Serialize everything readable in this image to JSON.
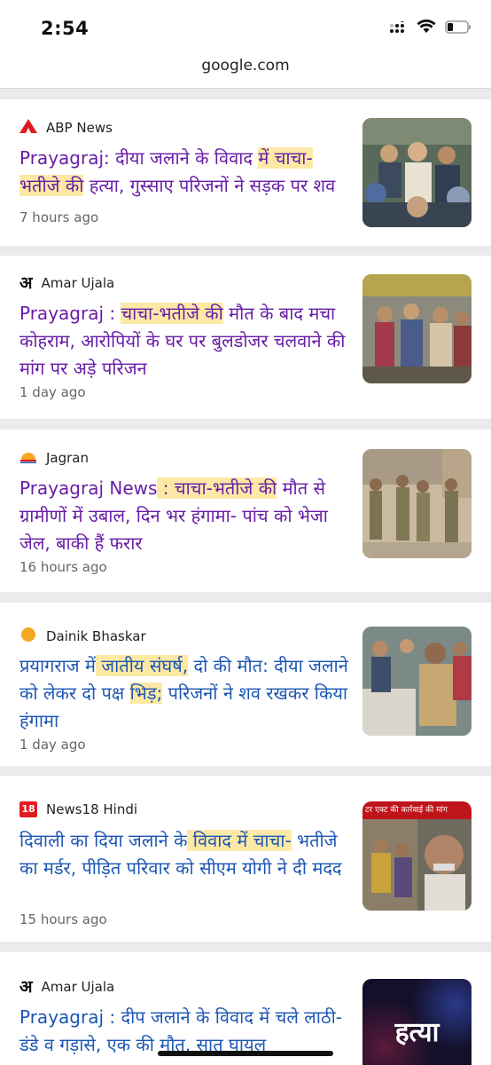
{
  "status_bar": {
    "time": "2:54"
  },
  "browser": {
    "url": "google.com"
  },
  "articles": [
    {
      "source": "ABP News",
      "headline_parts": [
        "Prayagraj: दीया जलाने के विवाद ",
        "में चाचा-",
        "",
        "भतीजे की",
        " हत्या, गुस्साए परिजनों ने सड़क पर शव"
      ],
      "time": "7 hours ago"
    },
    {
      "source": "Amar Ujala",
      "headline_parts": [
        "Prayagraj : ",
        "चाचा-भतीजे की",
        " मौत के बाद मचा कोहराम, आरोपियों के घर पर बुलडोजर चलवाने की मांग पर अड़े परिजन"
      ],
      "time": "1 day ago"
    },
    {
      "source": "Jagran",
      "headline_parts": [
        "Prayagraj News",
        " : चाचा-भतीजे क",
        "ी मौत से ग्रामीणों में उबाल, दिन भर हंगामा- पांच को भेजा जेल, बाकी हैं फरार"
      ],
      "time": "16 hours ago"
    },
    {
      "source": "Dainik Bhaskar",
      "headline_parts": [
        "प्रयागराज म",
        "ें जातीय संघर्ष,",
        " दो की मौत: दीया जलाने को लेकर दो पक्ष ",
        "भिड़;",
        " परिजनों ने शव रखकर किया हंगामा"
      ],
      "time": "1 day ago"
    },
    {
      "source": "News18 Hindi",
      "headline_parts": [
        "दिवाली का दिया जलाने क",
        "े विवाद में चाचा-",
        " भतीजे का मर्डर, पीड़ित परिवार को सीएम योगी ने दी मदद"
      ],
      "time": "15 hours ago"
    },
    {
      "source": "Amar Ujala",
      "headline_parts": [
        "Prayagraj : दीप जलाने के विवाद में चले लाठी-डंडे व गड़ासे, एक की मौत, सात घायल"
      ],
      "time": ""
    }
  ],
  "thumb_text": {
    "news18_banner": "टर एक्ट की कार्रवाई की मांग",
    "hatya": "हत्या"
  }
}
